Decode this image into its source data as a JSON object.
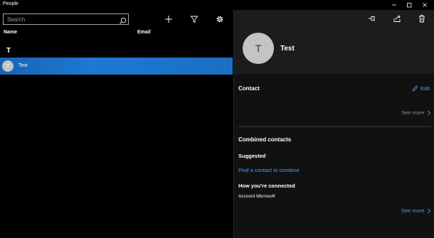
{
  "window": {
    "title": "People",
    "controls": {
      "minimize": "minimize-icon",
      "maximize": "maximize-icon",
      "close": "close-icon"
    }
  },
  "toolbar": {
    "search_placeholder": "Search",
    "icons": [
      "search-icon",
      "plus-icon",
      "filter-icon",
      "gear-icon"
    ]
  },
  "list": {
    "columns": {
      "name": "Name",
      "email": "Email"
    },
    "group_letter": "T",
    "contacts": [
      {
        "initial": "T",
        "name": "Test",
        "selected": true
      }
    ],
    "accent": "#1a6fc4"
  },
  "detail": {
    "avatar_initial": "T",
    "name": "Test",
    "header_icons": [
      "pin-icon",
      "share-icon",
      "delete-icon"
    ],
    "contact": {
      "heading": "Contact",
      "edit_label": "Edit",
      "see_more_label": "See more"
    },
    "combined": {
      "heading": "Combined contacts",
      "suggested_label": "Suggested",
      "find_link": "Find a contact to combine",
      "connected_heading": "How you're connected",
      "connected_account": "Account Microsoft",
      "see_more_label": "See more"
    },
    "link_color": "#4a9ef5"
  }
}
